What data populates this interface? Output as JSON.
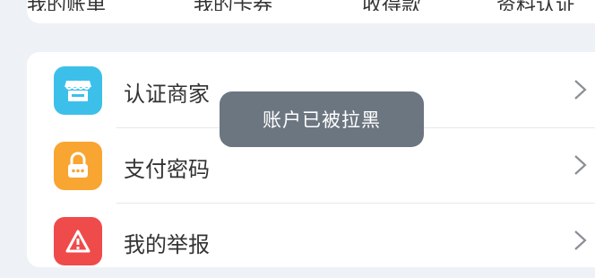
{
  "top_tabs": [
    {
      "label": "我的账单"
    },
    {
      "label": "我的卡券"
    },
    {
      "label": "收得款"
    },
    {
      "label": "资料认证"
    }
  ],
  "menu": {
    "items": [
      {
        "label": "认证商家",
        "icon": "store-icon",
        "color": "#3cc0ea"
      },
      {
        "label": "支付密码",
        "icon": "lock-icon",
        "color": "#f8a531"
      },
      {
        "label": "我的举报",
        "icon": "report-icon",
        "color": "#ef4b4b"
      }
    ]
  },
  "toast": {
    "message": "账户已被拉黑"
  }
}
